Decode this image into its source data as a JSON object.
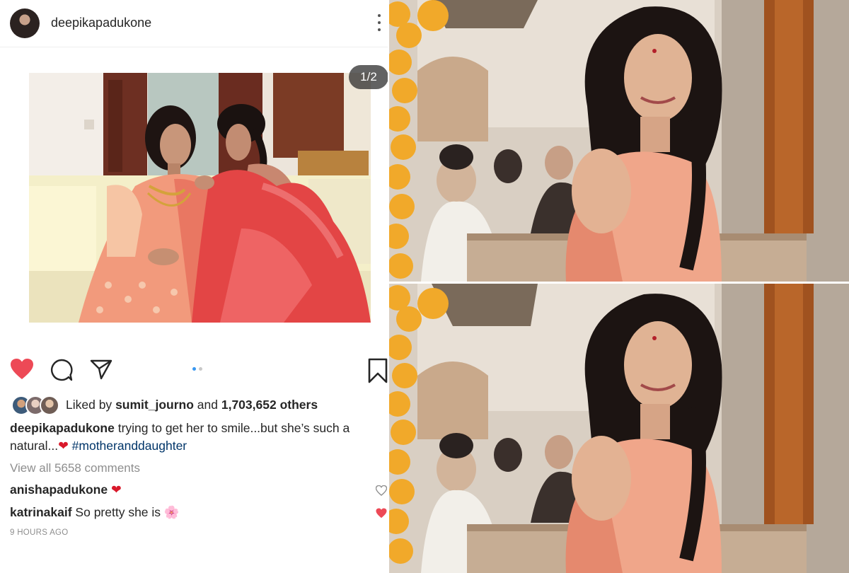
{
  "post": {
    "username": "deepikapadukone",
    "photo_counter": "1/2",
    "carousel": {
      "total": 2,
      "current": 1
    },
    "likes": {
      "prefix": "Liked by",
      "top_liker": "sumit_journo",
      "connector": "and",
      "count": "1,703,652 others"
    },
    "caption": {
      "username": "deepikapadukone",
      "text": "trying to get her to smile...but she’s such a natural...",
      "emoji": "❤",
      "hashtag": "#motheranddaughter"
    },
    "view_all_comments": "View all 5658 comments",
    "comments": [
      {
        "username": "anishapadukone",
        "text": "",
        "emoji": "❤"
      },
      {
        "username": "katrinakaif",
        "text": "So pretty she is",
        "emoji": "🌸"
      }
    ],
    "timestamp": "9 HOURS AGO"
  },
  "icons": {
    "header": [
      "avatar",
      "more-options-icon"
    ],
    "actions": [
      "heart-filled-icon",
      "comment-icon",
      "share-icon",
      "bookmark-icon"
    ],
    "comment_actions": [
      "heart-outline-icon",
      "heart-filled-icon"
    ]
  },
  "colors": {
    "like_red": "#ed4956",
    "hashtag_blue": "#003569",
    "muted_gray": "#8e8e8e",
    "text": "#262626",
    "carousel_active": "#3897f0"
  }
}
